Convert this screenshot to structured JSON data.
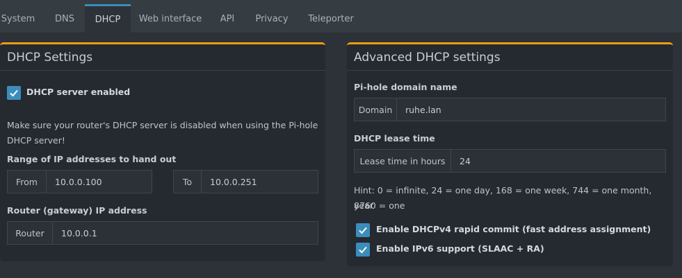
{
  "tabs": [
    {
      "label": "System"
    },
    {
      "label": "DNS"
    },
    {
      "label": "DHCP"
    },
    {
      "label": "Web interface"
    },
    {
      "label": "API"
    },
    {
      "label": "Privacy"
    },
    {
      "label": "Teleporter"
    }
  ],
  "active_tab": "DHCP",
  "dhcp_settings": {
    "title": "DHCP Settings",
    "server_enabled_label": "DHCP server enabled",
    "server_enabled": true,
    "warning_line1": "Make sure your router's DHCP server is disabled when using the Pi-hole",
    "warning_line2": "DHCP server!",
    "range_label": "Range of IP addresses to hand out",
    "from_addon": "From",
    "from_value": "10.0.0.100",
    "to_addon": "To",
    "to_value": "10.0.0.251",
    "router_label": "Router (gateway) IP address",
    "router_addon": "Router",
    "router_value": "10.0.0.1"
  },
  "advanced": {
    "title": "Advanced DHCP settings",
    "domain_label": "Pi-hole domain name",
    "domain_addon": "Domain",
    "domain_value": "ruhe.lan",
    "lease_label": "DHCP lease time",
    "lease_addon": "Lease time in hours",
    "lease_value": "24",
    "hint_line1": "Hint: 0 = infinite, 24 = one day, 168 = one week, 744 = one month, 8760 = one",
    "hint_line2": "year",
    "rapid_commit_label": "Enable DHCPv4 rapid commit (fast address assignment)",
    "rapid_commit": true,
    "ipv6_label": "Enable IPv6 support (SLAAC + RA)",
    "ipv6": true
  },
  "colors": {
    "accent": "#3c8dbc",
    "box_border": "#f39c12"
  }
}
